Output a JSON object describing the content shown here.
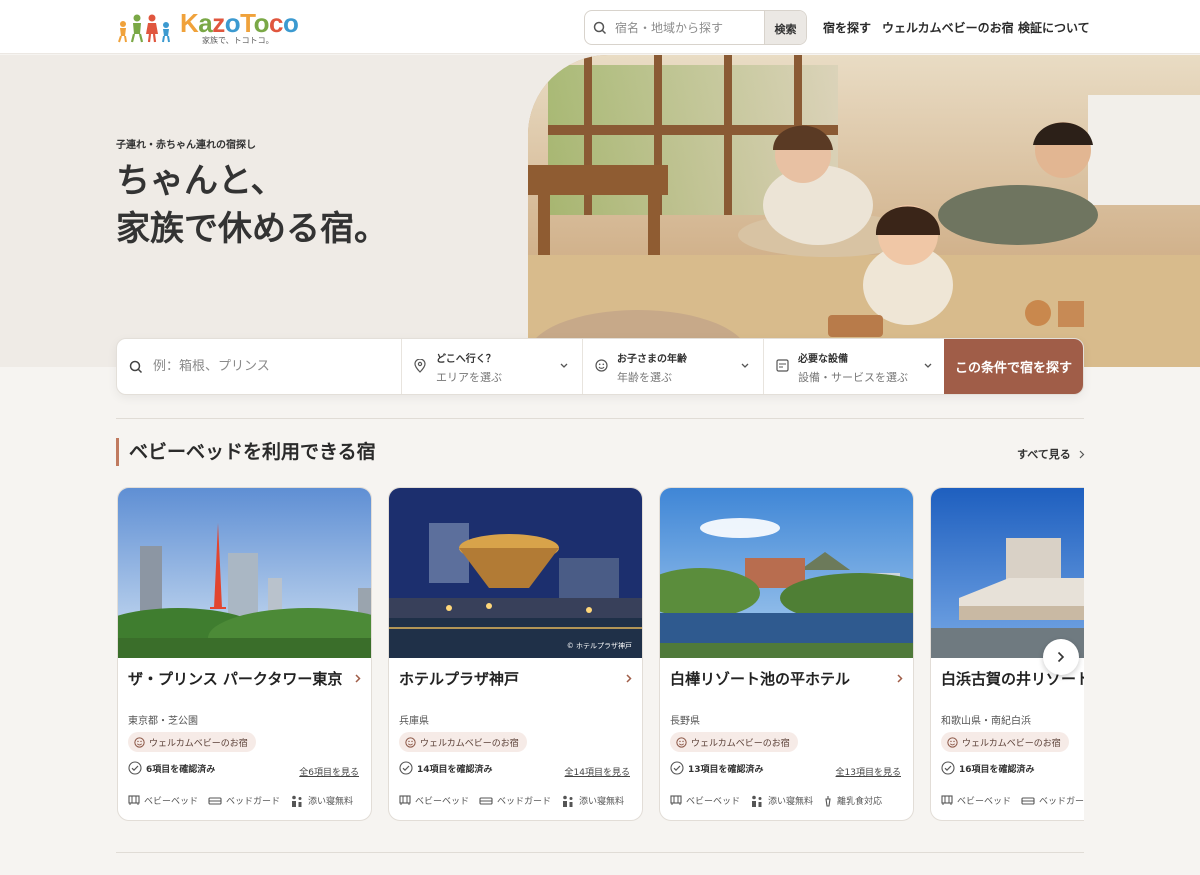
{
  "header": {
    "logo": {
      "word": "KazoToco",
      "tagline": "家族で、トコトコ。"
    },
    "search": {
      "placeholder": "宿名・地域から探す",
      "button": "検索"
    },
    "nav": [
      "宿を探す",
      "ウェルカムベビーのお宿",
      "検証について"
    ]
  },
  "hero": {
    "eyebrow": "子連れ・赤ちゃん連れの宿探し",
    "title_line1": "ちゃんと、",
    "title_line2": "家族で休める宿。"
  },
  "filter": {
    "keyword_placeholder": "例：箱根、プリンス",
    "where": {
      "label": "どこへ行く？",
      "value": "エリアを選ぶ"
    },
    "age": {
      "label": "お子さまの年齢",
      "value": "年齢を選ぶ"
    },
    "facility": {
      "label": "必要な設備",
      "value": "設備・サービスを選ぶ"
    },
    "submit": "この条件で宿を探す"
  },
  "section": {
    "title": "ベビーベッドを利用できる宿",
    "see_all": "すべて見る"
  },
  "cards": [
    {
      "name": "ザ・プリンス パークタワー東京",
      "location": "東京都・芝公園",
      "badge": "ウェルカムベビーのお宿",
      "verified": "6項目を確認済み",
      "see_all": "全6項目を見る",
      "features": [
        "ベビーベッド",
        "ベッドガード",
        "添い寝無料"
      ],
      "feature_icons": [
        "crib-icon",
        "bed-guard-icon",
        "co-sleeping-icon"
      ],
      "credit": ""
    },
    {
      "name": "ホテルプラザ神戸",
      "location": "兵庫県",
      "badge": "ウェルカムベビーのお宿",
      "verified": "14項目を確認済み",
      "see_all": "全14項目を見る",
      "features": [
        "ベビーベッド",
        "ベッドガード",
        "添い寝無料"
      ],
      "feature_icons": [
        "crib-icon",
        "bed-guard-icon",
        "co-sleeping-icon"
      ],
      "credit": "© ホテルプラザ神戸"
    },
    {
      "name": "白樺リゾート池の平ホテル",
      "location": "長野県",
      "badge": "ウェルカムベビーのお宿",
      "verified": "13項目を確認済み",
      "see_all": "全13項目を見る",
      "features": [
        "ベビーベッド",
        "添い寝無料",
        "離乳食対応"
      ],
      "feature_icons": [
        "crib-icon",
        "co-sleeping-icon",
        "baby-food-icon"
      ],
      "credit": ""
    },
    {
      "name": "白浜古賀の井リゾート",
      "location": "和歌山県・南紀白浜",
      "badge": "ウェルカムベビーのお宿",
      "verified": "16項目を確認済み",
      "see_all": "",
      "features": [
        "ベビーベッド",
        "ベッドガード"
      ],
      "feature_icons": [
        "crib-icon",
        "bed-guard-icon"
      ],
      "credit": ""
    }
  ],
  "colors": {
    "accent": "#a05d48",
    "section_bar": "#c07a5f",
    "badge_bg": "#f6ebe7"
  }
}
